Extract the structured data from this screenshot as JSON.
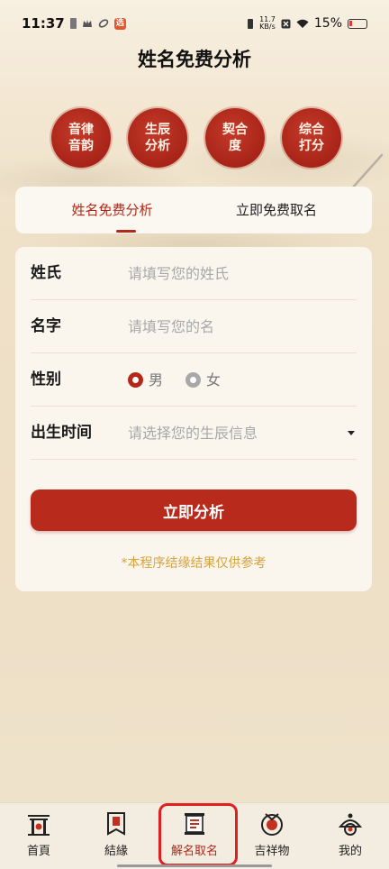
{
  "status_bar": {
    "time": "11:37",
    "net_speed_value": "11.7",
    "net_speed_unit": "KB/s",
    "battery": "15%"
  },
  "header": {
    "title": "姓名免费分析"
  },
  "seals": [
    "音律音韵",
    "生辰分析",
    "契合度",
    "综合打分"
  ],
  "tabs": [
    {
      "label": "姓名免费分析",
      "active": true
    },
    {
      "label": "立即免费取名",
      "active": false
    }
  ],
  "form": {
    "surname_label": "姓氏",
    "surname_placeholder": "请填写您的姓氏",
    "name_label": "名字",
    "name_placeholder": "请填写您的名",
    "gender_label": "性别",
    "gender_male": "男",
    "gender_female": "女",
    "birth_label": "出生时间",
    "birth_placeholder": "请选择您的生辰信息",
    "submit_label": "立即分析",
    "disclaimer": "*本程序结缘结果仅供参考"
  },
  "bottom_nav": [
    {
      "label": "首頁",
      "icon": "gate-icon"
    },
    {
      "label": "結緣",
      "icon": "banner-icon"
    },
    {
      "label": "解名取名",
      "icon": "scroll-icon",
      "active": true
    },
    {
      "label": "吉祥物",
      "icon": "coin-icon"
    },
    {
      "label": "我的",
      "icon": "profile-icon"
    }
  ],
  "colors": {
    "accent": "#b32819",
    "disclaimer": "#d4a340",
    "background": "#efe3cc"
  }
}
